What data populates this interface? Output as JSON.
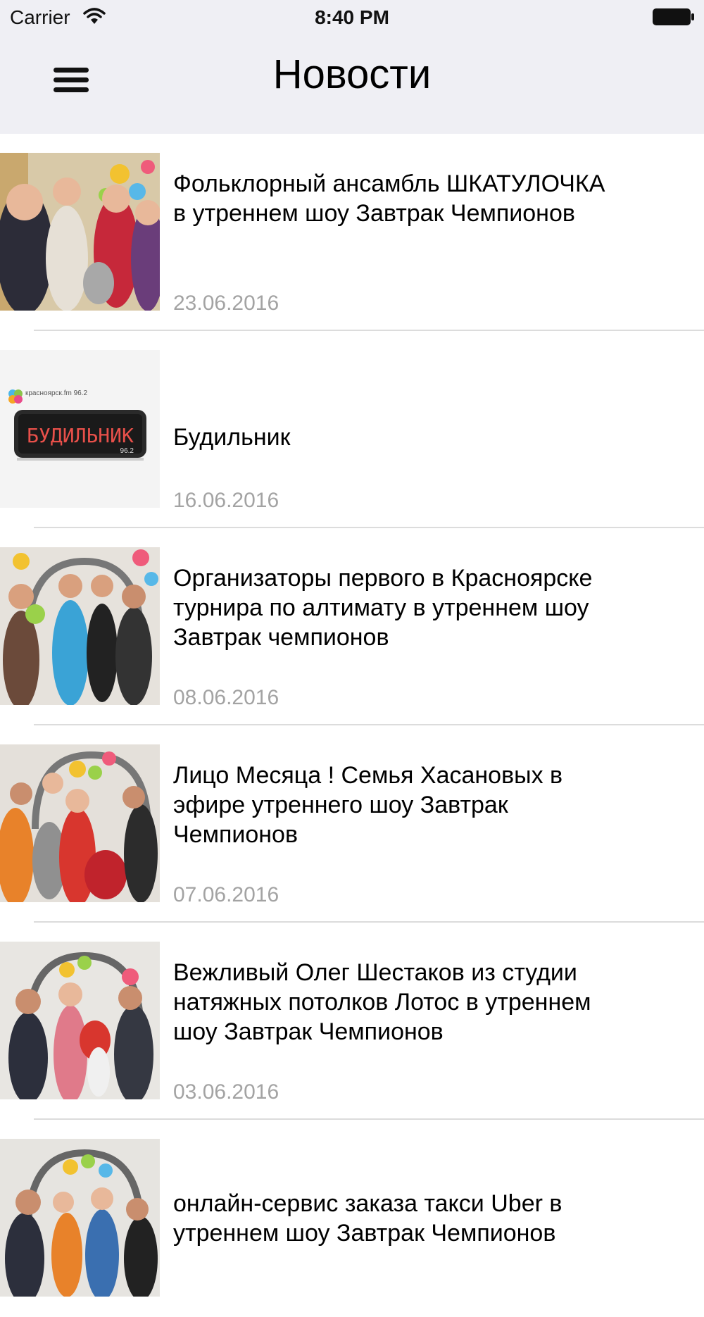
{
  "status_bar": {
    "carrier": "Carrier",
    "time": "8:40 PM",
    "icons": [
      "wifi-icon",
      "battery-icon"
    ]
  },
  "nav": {
    "title": "Новости",
    "menu_icon": "hamburger-menu-icon"
  },
  "news": [
    {
      "title": "Фольклорный ансамбль ШКАТУЛОЧКА в утреннем шоу Завтрак Чемпионов",
      "date": "23.06.2016",
      "thumbnail": "photo"
    },
    {
      "title": "Будильник",
      "date": "16.06.2016",
      "thumbnail": "logo",
      "logo_brand": "красноярск.fm 96.2",
      "logo_display": "БУДИЛЬНИК",
      "logo_freq": "96.2"
    },
    {
      "title": "Организаторы первого в Красноярске турнира по алтимату в утреннем шоу Завтрак чемпионов",
      "date": "08.06.2016",
      "thumbnail": "photo"
    },
    {
      "title": "Лицо Месяца ! Семья Хасановых в эфире утреннего шоу Завтрак Чемпионов",
      "date": "07.06.2016",
      "thumbnail": "photo"
    },
    {
      "title": "Вежливый Олег Шестаков из студии натяжных потолков Лотос в утреннем шоу Завтрак Чемпионов",
      "date": "03.06.2016",
      "thumbnail": "photo"
    },
    {
      "title": "онлайн-сервис заказа такси Uber в утреннем шоу Завтрак Чемпионов",
      "date": "",
      "thumbnail": "photo"
    }
  ],
  "colors": {
    "bar_background": "#efeff4",
    "date_gray": "#a3a3a3",
    "separator": "#dcdcdc"
  }
}
